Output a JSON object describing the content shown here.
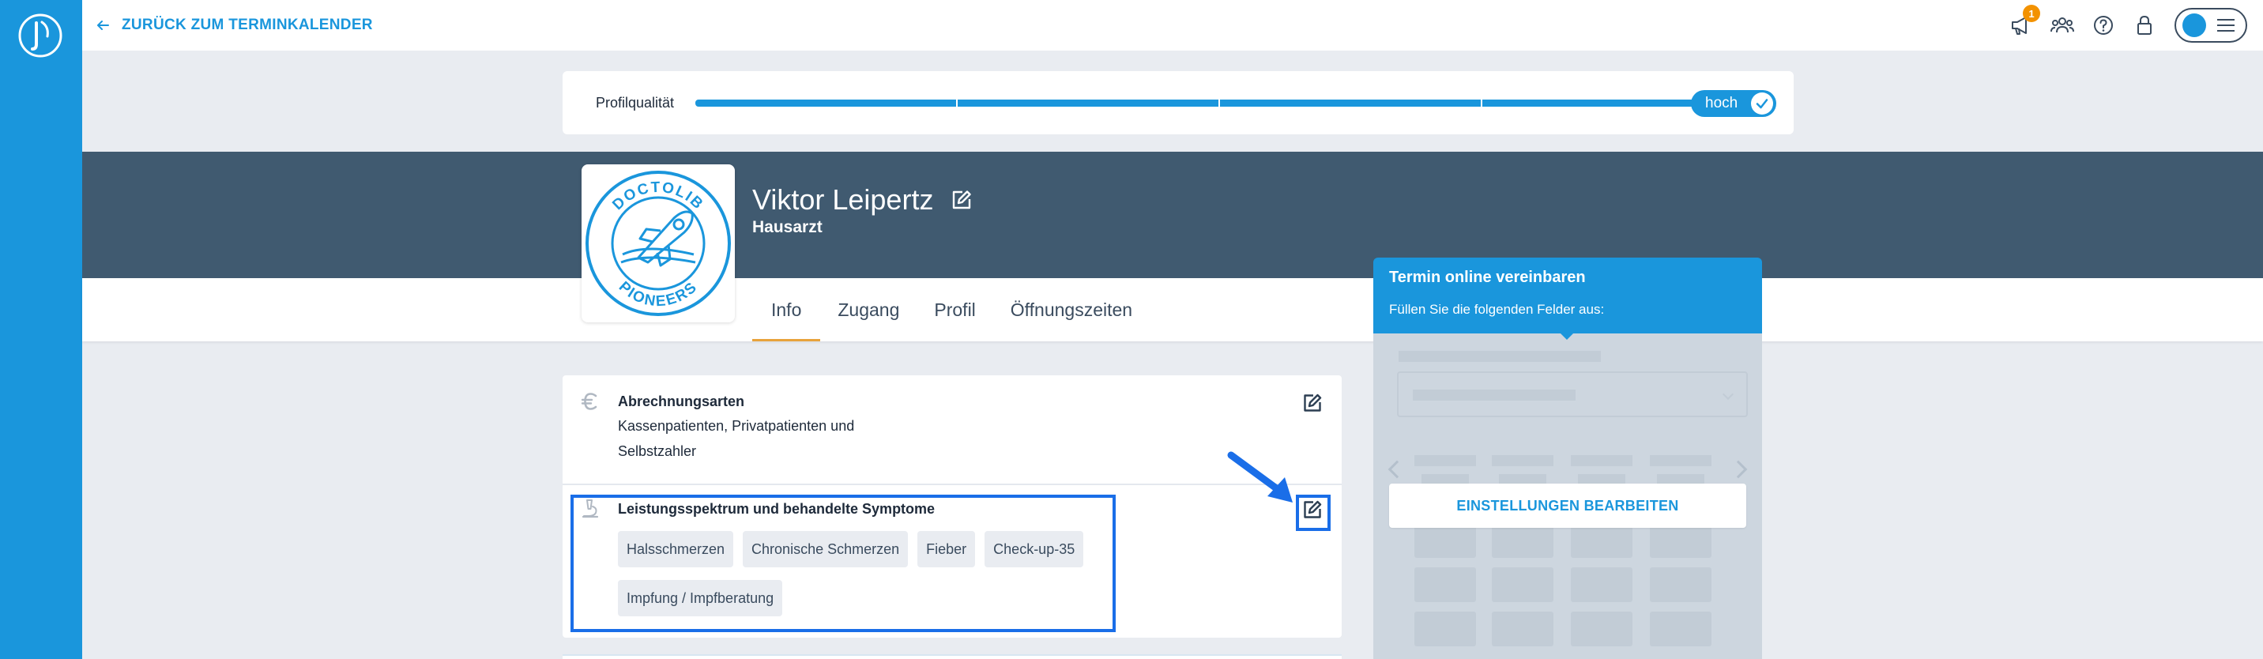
{
  "topbar": {
    "back_label": "ZURÜCK ZUM TERMINKALENDER",
    "notifications_count": "1"
  },
  "quality": {
    "label": "Profilqualität",
    "level": "hoch",
    "progress_percent": 100,
    "segments": 5
  },
  "profile": {
    "name": "Viktor Leipertz",
    "title": "Hausarzt",
    "badge_top_text": "DOCTOLIB",
    "badge_bottom_text": "PIONEERS"
  },
  "tabs": [
    {
      "label": "Info",
      "active": true
    },
    {
      "label": "Zugang",
      "active": false
    },
    {
      "label": "Profil",
      "active": false
    },
    {
      "label": "Öffnungszeiten",
      "active": false
    }
  ],
  "billing": {
    "icon": "euro-icon",
    "title": "Abrechnungsarten",
    "text": "Kassenpatienten, Privatpatienten und Selbstzahler"
  },
  "services": {
    "icon": "microscope-icon",
    "title": "Leistungsspektrum und behandelte Symptome",
    "tags": [
      "Halsschmerzen",
      "Chronische Schmerzen",
      "Fieber",
      "Check-up-35",
      "Impfung / Impfberatung"
    ]
  },
  "booking": {
    "title": "Termin online vereinbaren",
    "subtitle": "Füllen Sie die folgenden Felder aus:",
    "settings_button": "EINSTELLUNGEN BEARBEITEN"
  },
  "colors": {
    "brand_blue": "#1a96dc",
    "header_band": "#405a70",
    "highlight": "#1a6ee8",
    "badge_orange": "#f39200",
    "tab_underline": "#e8a33c"
  }
}
